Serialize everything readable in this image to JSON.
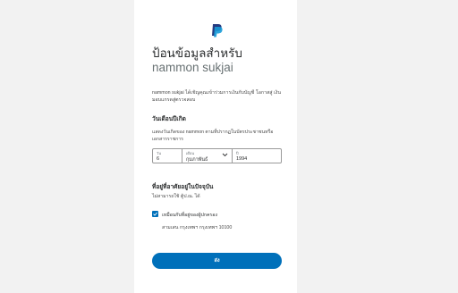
{
  "form": {
    "title_prefix": "ป้อนข้อมูลสำหรับ",
    "title_name": "nammon sukjai",
    "description": "nammon sukjai ได้เชิญคุณเข้าร่วมการเงินกับบัญชี โอกาสสู่ เงิน มอบแกรดสู่ตรวจสอบ",
    "dob_heading": "วันเดือนปีเกิด",
    "dob_note": "แสดงวันเกิดของ nammon ตามที่ปรากฏในบัตรประชาชนหรือเอกสารราชการ",
    "dob": {
      "day_label": "วัน",
      "day_value": "6",
      "month_label": "เดือน",
      "month_value": "กุมภาพันธ์",
      "year_label": "ปี",
      "year_value": "1994"
    },
    "address_heading": "ที่อยู่ที่อาศัยอยู่ในปัจจุบัน",
    "address_note": "ไม่สามารถใช้ ตู้ป.ณ. ได้",
    "same_address_label": "เหมือนกับที่อยู่ของผู้ปกครอง",
    "address_value": "สามเสน กรุงเทพฯ กรุงเทพฯ 10100",
    "submit_label": "ส่ง"
  },
  "colors": {
    "accent": "#0070ba",
    "background": "#f2f2f2",
    "card": "#ffffff"
  },
  "icons": {
    "logo": "paypal-logo-icon",
    "month_dropdown": "chevron-down-icon",
    "checkbox": "checkmark-icon"
  }
}
